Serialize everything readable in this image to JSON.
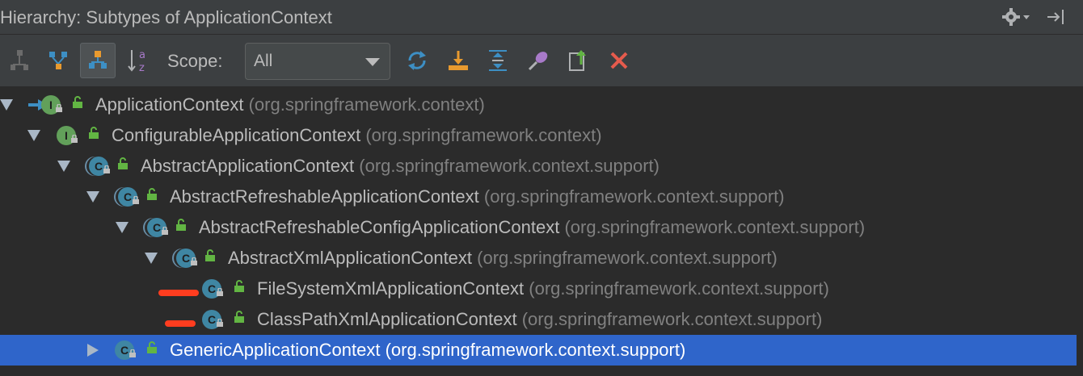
{
  "title": "Hierarchy: Subtypes of ApplicationContext",
  "toolbar": {
    "scope_label": "Scope:",
    "scope_value": "All",
    "buttons": [
      "supertypes-hierarchy-icon",
      "type-hierarchy-icon",
      "subtypes-hierarchy-icon",
      "sort-alphabetically-icon",
      "refresh-icon",
      "export-icon",
      "expand-all-icon",
      "pin-icon",
      "open-in-tab-icon",
      "close-icon"
    ]
  },
  "tree": [
    {
      "name": "ApplicationContext",
      "package": "(org.springframework.context)",
      "kind": "interface",
      "expanded": true,
      "base": true
    },
    {
      "name": "ConfigurableApplicationContext",
      "package": "(org.springframework.context)",
      "kind": "interface",
      "expanded": true
    },
    {
      "name": "AbstractApplicationContext",
      "package": "(org.springframework.context.support)",
      "kind": "abstract-class",
      "expanded": true
    },
    {
      "name": "AbstractRefreshableApplicationContext",
      "package": "(org.springframework.context.support)",
      "kind": "abstract-class",
      "expanded": true
    },
    {
      "name": "AbstractRefreshableConfigApplicationContext",
      "package": "(org.springframework.context.support)",
      "kind": "abstract-class",
      "expanded": true
    },
    {
      "name": "AbstractXmlApplicationContext",
      "package": "(org.springframework.context.support)",
      "kind": "abstract-class",
      "expanded": true
    },
    {
      "name": "FileSystemXmlApplicationContext",
      "package": "(org.springframework.context.support)",
      "kind": "class",
      "marked": true
    },
    {
      "name": "ClassPathXmlApplicationContext",
      "package": "(org.springframework.context.support)",
      "kind": "class",
      "marked": true
    },
    {
      "name": "GenericApplicationContext",
      "package": "(org.springframework.context.support)",
      "kind": "class",
      "expanded": false,
      "selected": true
    }
  ],
  "colors": {
    "selection": "#2f65ca",
    "interface_badge": "#62a05a",
    "class_badge": "#3f86a3",
    "highlight_mark": "#ff3d1f"
  }
}
